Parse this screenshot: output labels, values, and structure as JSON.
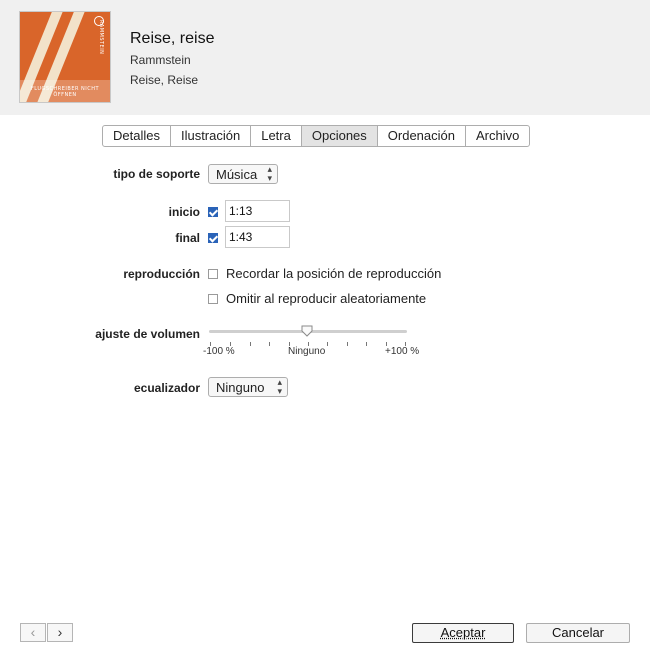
{
  "track": {
    "title": "Reise, reise",
    "artist": "Rammstein",
    "album": "Reise, Reise",
    "art_vertical_text": "RAMMSTEIN",
    "art_band_text": "FLUGSCHREIBER NICHT ÖFFNEN"
  },
  "tabs": [
    {
      "label": "Detalles",
      "active": false
    },
    {
      "label": "Ilustración",
      "active": false
    },
    {
      "label": "Letra",
      "active": false
    },
    {
      "label": "Opciones",
      "active": true
    },
    {
      "label": "Ordenación",
      "active": false
    },
    {
      "label": "Archivo",
      "active": false
    }
  ],
  "options": {
    "media_kind_label": "tipo de soporte",
    "media_kind_value": "Música",
    "start_label": "inicio",
    "start_checked": true,
    "start_value": "1:13",
    "stop_label": "final",
    "stop_checked": true,
    "stop_value": "1:43",
    "playback_label": "reproducción",
    "remember_position_label": "Recordar la posición de reproducción",
    "remember_position_checked": false,
    "skip_shuffle_label": "Omitir al reproducir aleatoriamente",
    "skip_shuffle_checked": false,
    "volume_label": "ajuste de volumen",
    "volume_min_label": "-100 %",
    "volume_mid_label": "Ninguno",
    "volume_max_label": "+100 %",
    "volume_value_percent": 0,
    "equalizer_label": "ecualizador",
    "equalizer_value": "Ninguno"
  },
  "footer": {
    "prev_symbol": "‹",
    "next_symbol": "›",
    "ok_label": "Aceptar",
    "cancel_label": "Cancelar"
  },
  "colors": {
    "header_bg": "#f0f0f0",
    "checkbox_checked": "#2a63b8",
    "art_orange": "#d9652a"
  }
}
